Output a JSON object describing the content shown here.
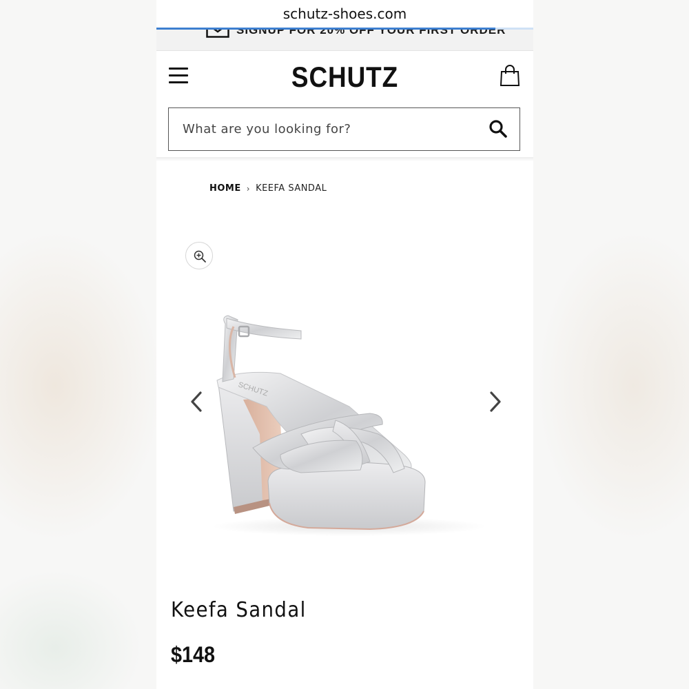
{
  "browser": {
    "url": "schutz-shoes.com",
    "load_progress": 0.9
  },
  "promo_banner": {
    "text": "SIGNUP FOR 20% OFF YOUR FIRST ORDER",
    "icon": "envelope-icon"
  },
  "header": {
    "logo": "SCHUTZ",
    "menu_icon": "hamburger-icon",
    "bag_icon": "shopping-bag-icon"
  },
  "search": {
    "placeholder": "What are you looking for?",
    "icon": "search-icon"
  },
  "breadcrumb": {
    "home": "HOME",
    "separator": "›",
    "current": "KEEFA SANDAL"
  },
  "product": {
    "name": "Keefa Sandal",
    "price": "$148",
    "image_brand_stamp": "SCHUTZ",
    "gallery": {
      "zoom_icon": "zoom-in-icon",
      "prev_icon": "chevron-left-icon",
      "next_icon": "chevron-right-icon"
    }
  },
  "colors": {
    "text": "#111111",
    "page_bg": "#ffffff",
    "promo_bg": "#f2f2f2",
    "progress": "#3d7fd0",
    "sandal_silver": "#d9dadc",
    "sandal_heel_lining": "#e3c2b0"
  }
}
